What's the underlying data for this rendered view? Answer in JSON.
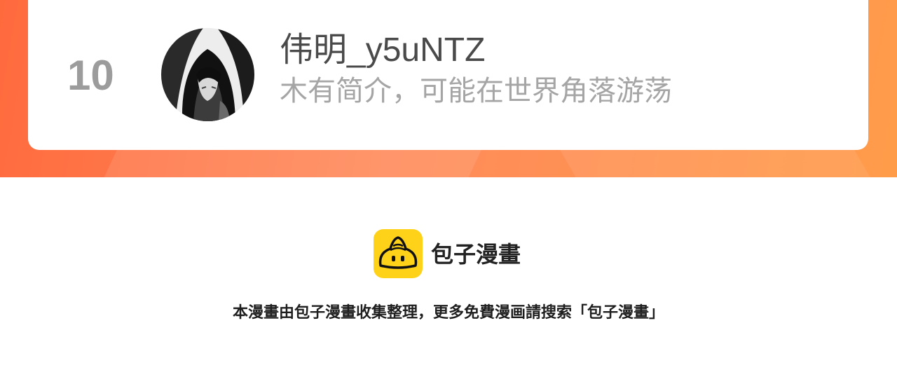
{
  "ranking_entry": {
    "rank": "10",
    "username": "伟明_y5uNTZ",
    "bio": "木有简介，可能在世界角落游荡",
    "avatar_icon": "hooded-figure-avatar"
  },
  "branding": {
    "logo_icon": "steamed-bun-icon",
    "logo_color": "#ffd21a",
    "app_name": "包子漫畫",
    "notice": "本漫畫由包子漫畫收集整理，更多免費漫画請搜索「包子漫畫」"
  },
  "colors": {
    "banner_start": "#ff6a3d",
    "banner_end": "#ff9c4a",
    "rank_text": "#9c9c9c",
    "username_text": "#4a4a4a",
    "bio_text": "#a5a5a5"
  }
}
